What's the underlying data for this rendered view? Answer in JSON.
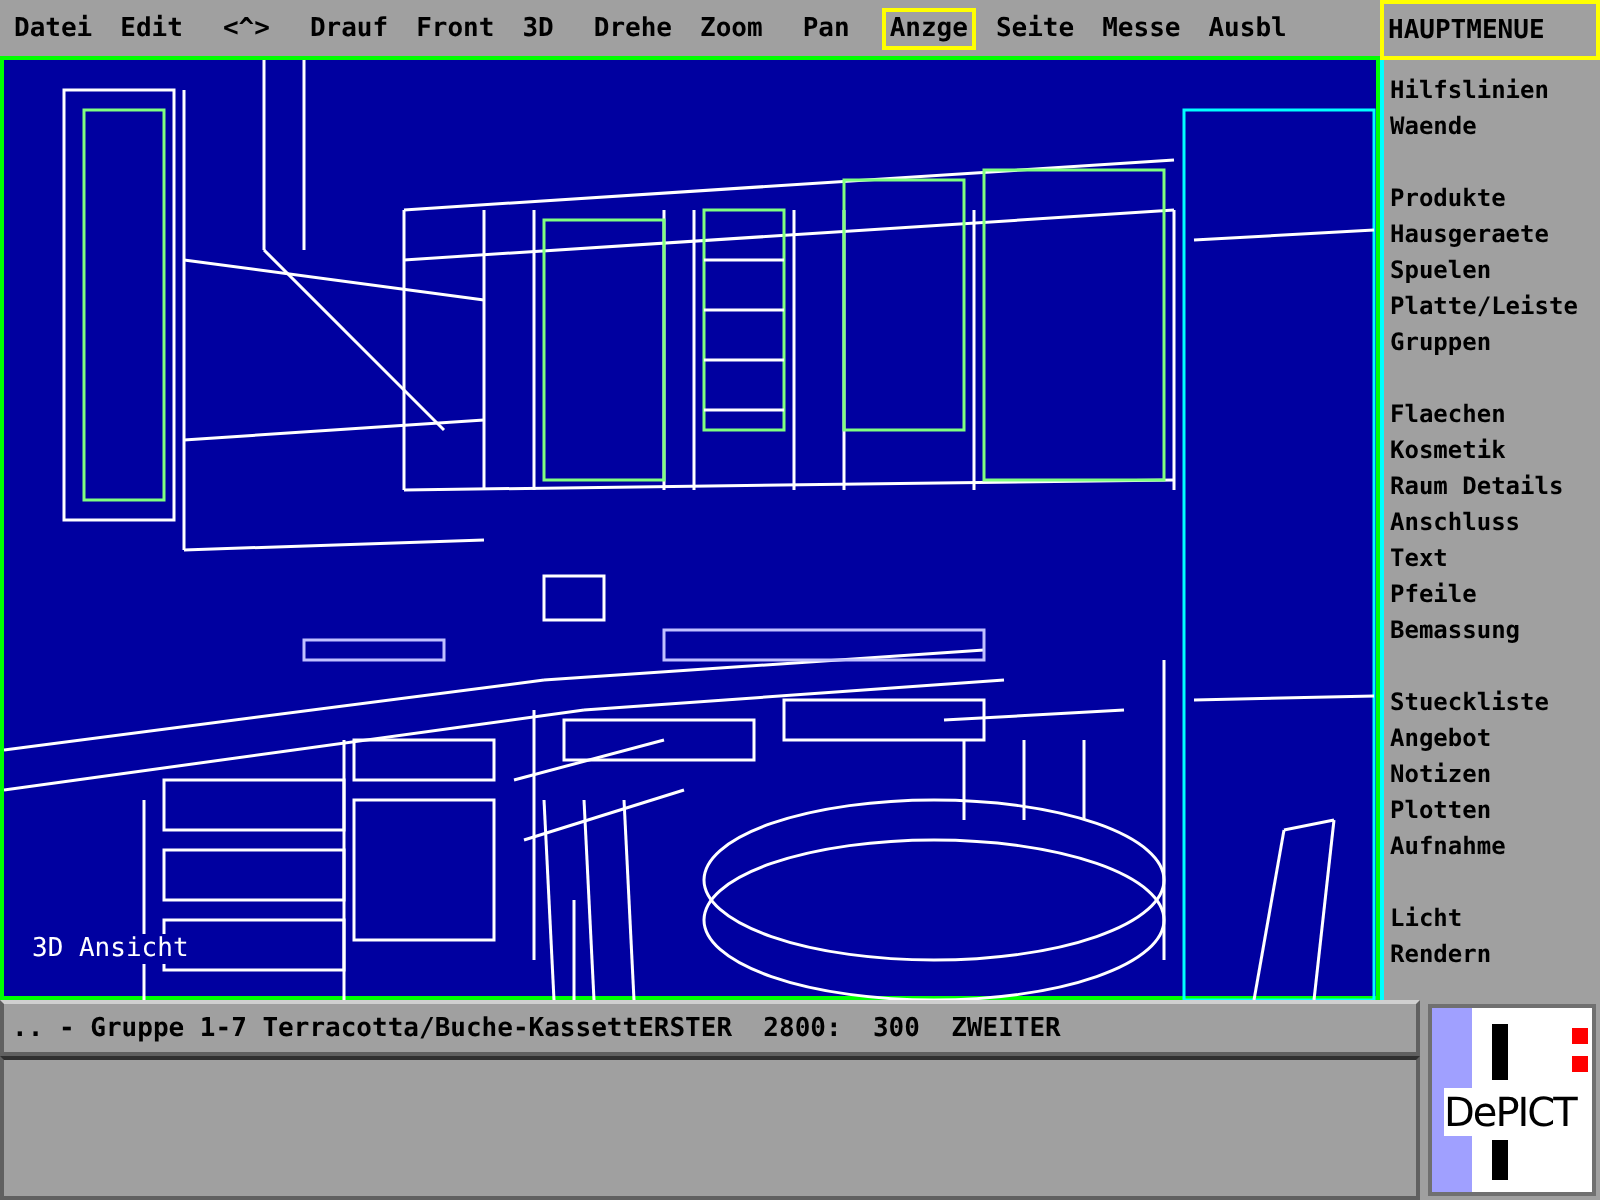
{
  "menu_groups": [
    [
      {
        "label": "Datei",
        "selected": false
      },
      {
        "label": "Edit",
        "selected": false
      }
    ],
    [
      {
        "label": "<^>",
        "selected": false
      }
    ],
    [
      {
        "label": "Drauf",
        "selected": false
      },
      {
        "label": "Front",
        "selected": false
      },
      {
        "label": "3D",
        "selected": false
      }
    ],
    [
      {
        "label": "Drehe",
        "selected": false
      },
      {
        "label": "Zoom",
        "selected": false
      }
    ],
    [
      {
        "label": "Pan",
        "selected": false
      }
    ],
    [
      {
        "label": "Anzge",
        "selected": true
      },
      {
        "label": "Seite",
        "selected": false
      },
      {
        "label": "Messe",
        "selected": false
      },
      {
        "label": "Ausbl",
        "selected": false
      }
    ]
  ],
  "sidebar": {
    "title": "HAUPTMENUE",
    "groups": [
      [
        "Hilfslinien",
        "Waende"
      ],
      [
        "Produkte",
        "Hausgeraete",
        "Spuelen",
        "Platte/Leiste",
        "Gruppen"
      ],
      [
        "Flaechen",
        "Kosmetik",
        "Raum Details",
        "Anschluss",
        "Text",
        "Pfeile",
        "Bemassung"
      ],
      [
        "Stueckliste",
        "Angebot",
        "Notizen",
        "Plotten",
        "Aufnahme"
      ],
      [
        "Licht",
        "Rendern"
      ]
    ]
  },
  "viewport": {
    "label": "3D Ansicht"
  },
  "status_bar": ".. - Gruppe 1-7 Terracotta/Buche-KassettERSTER  2800:  300  ZWEITER",
  "logo": {
    "text": "DePICT"
  }
}
